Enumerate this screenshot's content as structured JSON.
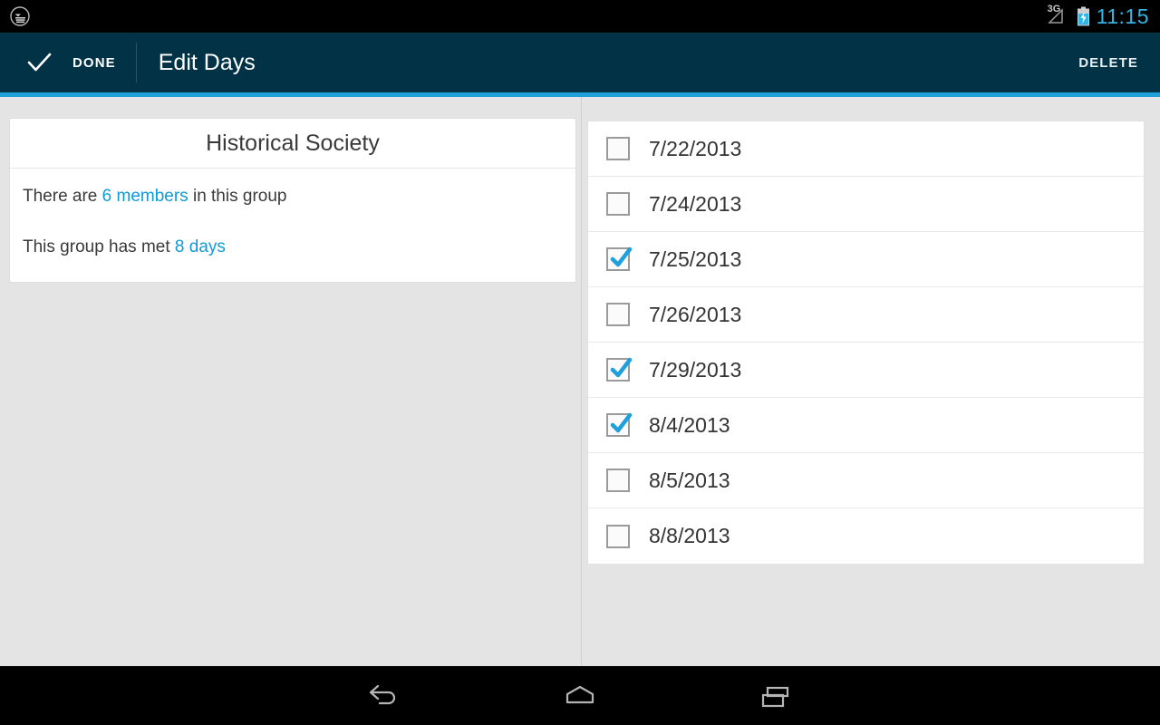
{
  "status_bar": {
    "app_icon": "app-notification-icon",
    "network_label": "3G",
    "signal_icon": "signal-triangle-icon",
    "battery_icon": "battery-charging-icon",
    "time": "11:15",
    "time_color": "#33b5e5"
  },
  "action_bar": {
    "background_color": "#023246",
    "accent_color": "#1fa0da",
    "done_icon": "checkmark-icon",
    "done_label": "DONE",
    "title": "Edit Days",
    "delete_label": "DELETE"
  },
  "left_panel": {
    "card": {
      "title": "Historical Society",
      "lines": [
        {
          "prefix": "There are ",
          "highlight": "6 members",
          "suffix": " in this group"
        },
        {
          "prefix": "This group has met ",
          "highlight": "8 days",
          "suffix": ""
        }
      ],
      "highlight_color": "#0f9bd7"
    }
  },
  "right_panel": {
    "checkbox_checked_color": "#1fa0da",
    "dates": [
      {
        "label": "7/22/2013",
        "checked": false
      },
      {
        "label": "7/24/2013",
        "checked": false
      },
      {
        "label": "7/25/2013",
        "checked": true
      },
      {
        "label": "7/26/2013",
        "checked": false
      },
      {
        "label": "7/29/2013",
        "checked": true
      },
      {
        "label": "8/4/2013",
        "checked": true
      },
      {
        "label": "8/5/2013",
        "checked": false
      },
      {
        "label": "8/8/2013",
        "checked": false
      }
    ]
  },
  "nav_bar": {
    "back_icon": "back-arrow-icon",
    "home_icon": "home-icon",
    "recents_icon": "recent-apps-icon"
  }
}
